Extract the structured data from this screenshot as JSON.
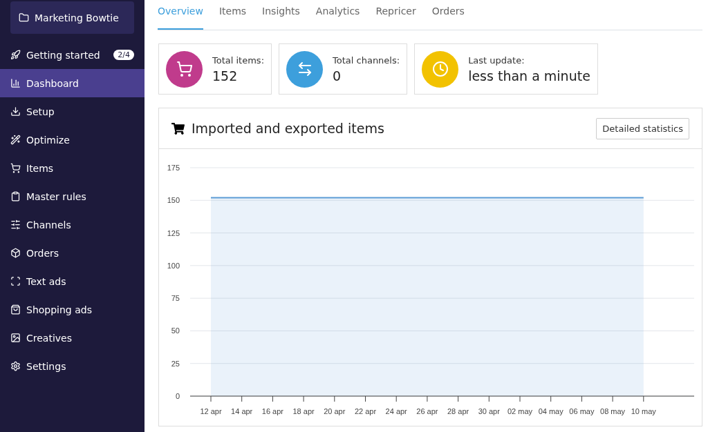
{
  "workspace": {
    "name": "Marketing Bowtie"
  },
  "sidebar": {
    "items": [
      {
        "kind": "rocket",
        "label": "Getting started",
        "badge": "2/4",
        "selected": false
      },
      {
        "kind": "chart",
        "label": "Dashboard",
        "selected": true
      },
      {
        "kind": "download",
        "label": "Setup",
        "selected": false
      },
      {
        "kind": "wand",
        "label": "Optimize",
        "selected": false
      },
      {
        "kind": "cart",
        "label": "Items",
        "selected": false
      },
      {
        "kind": "clipboard",
        "label": "Master rules",
        "selected": false
      },
      {
        "kind": "channels",
        "label": "Channels",
        "selected": false
      },
      {
        "kind": "box",
        "label": "Orders",
        "selected": false
      },
      {
        "kind": "frame",
        "label": "Text ads",
        "selected": false
      },
      {
        "kind": "bag",
        "label": "Shopping ads",
        "selected": false
      },
      {
        "kind": "image",
        "label": "Creatives",
        "selected": false
      },
      {
        "kind": "gear",
        "label": "Settings",
        "selected": false
      }
    ]
  },
  "tabs": [
    {
      "label": "Overview",
      "selected": true
    },
    {
      "label": "Items",
      "selected": false
    },
    {
      "label": "Insights",
      "selected": false
    },
    {
      "label": "Analytics",
      "selected": false
    },
    {
      "label": "Repricer",
      "selected": false
    },
    {
      "label": "Orders",
      "selected": false
    }
  ],
  "stats": [
    {
      "kind": "cart",
      "label": "Total items:",
      "value": "152",
      "color": "#c03b8c"
    },
    {
      "kind": "arrows",
      "label": "Total channels:",
      "value": "0",
      "color": "#3d9fdc"
    },
    {
      "kind": "clock",
      "label": "Last update:",
      "value": "less than a minute",
      "color": "#f2c200"
    }
  ],
  "panel": {
    "title": "Imported and exported items",
    "button": "Detailed statistics",
    "chart_data": {
      "type": "area",
      "categories": [
        "12 apr",
        "14 apr",
        "16 apr",
        "18 apr",
        "20 apr",
        "22 apr",
        "24 apr",
        "26 apr",
        "28 apr",
        "30 apr",
        "02 may",
        "04 may",
        "06 may",
        "08 may",
        "10 may"
      ],
      "grid": true,
      "series": [
        {
          "color": "#5b9bd5",
          "values": [
            152,
            152,
            152,
            152,
            152,
            152,
            152,
            152,
            152,
            152,
            152,
            152,
            152,
            152,
            152
          ]
        }
      ],
      "ylim": [
        0,
        175
      ],
      "yticks": [
        0,
        25,
        50,
        75,
        100,
        125,
        150,
        175
      ]
    }
  }
}
